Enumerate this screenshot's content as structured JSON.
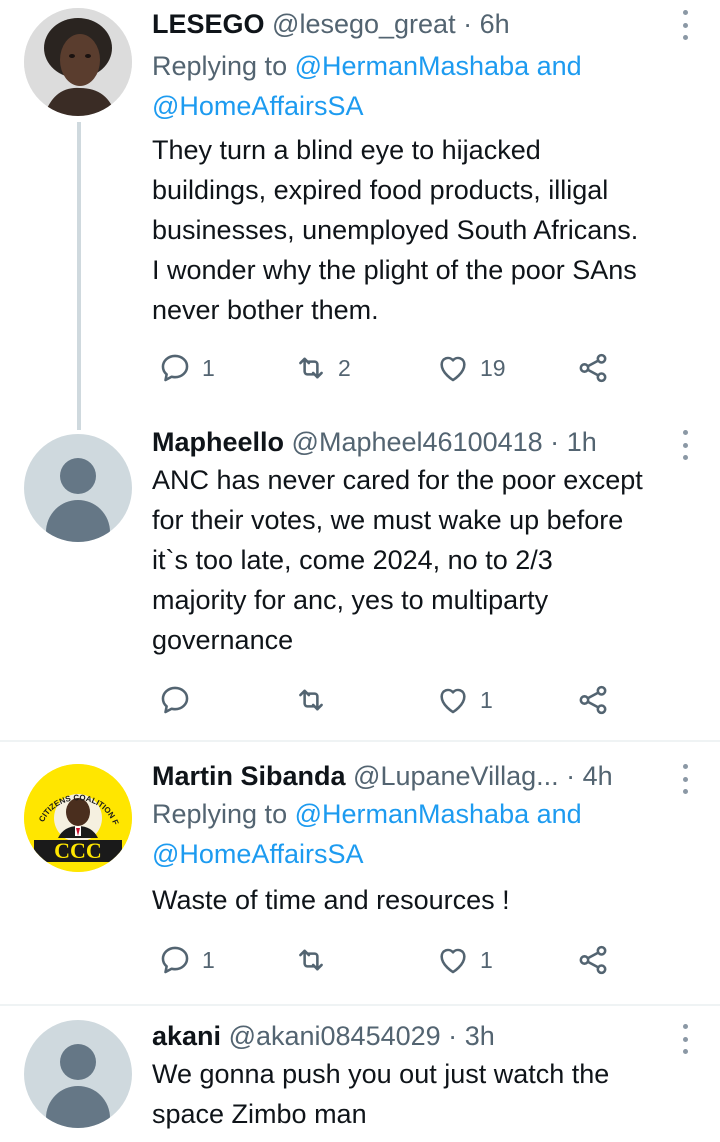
{
  "tweets": [
    {
      "name": "LESEGO",
      "handle": "@lesego_great",
      "dot": "·",
      "time": "6h",
      "replying_prefix": "Replying to ",
      "replying_to_1": "@HermanMashaba",
      "replying_and": " and",
      "replying_to_2": "@HomeAffairsSA",
      "text_lines": [
        "They turn a blind eye to hijacked",
        "buildings, expired food products, illigal",
        "businesses, unemployed South Africans.",
        "I wonder why the plight of the poor SAns",
        "never bother them."
      ],
      "replies": "1",
      "retweets": "2",
      "likes": "19"
    },
    {
      "name": "Mapheello",
      "handle": "@Mapheel46100418",
      "dot": "·",
      "time": "1h",
      "text_lines": [
        "ANC has never cared for the poor except",
        "for their votes, we must wake up before",
        "it`s too late, come 2024, no to 2/3",
        "majority for anc, yes to multiparty",
        "governance"
      ],
      "replies": "",
      "retweets": "",
      "likes": "1"
    },
    {
      "name": "Martin Sibanda",
      "handle": "@LupaneVillag...",
      "dot": "·",
      "time": "4h",
      "replying_prefix": "Replying to ",
      "replying_to_1": "@HermanMashaba",
      "replying_and": " and",
      "replying_to_2": "@HomeAffairsSA",
      "text_lines": [
        "Waste of time and resources !"
      ],
      "replies": "1",
      "retweets": "",
      "likes": "1",
      "avatar_logo_text": "CCC",
      "avatar_ring_text": "CITIZENS COALITION FOR CHANGE"
    },
    {
      "name": "akani",
      "handle": "@akani08454029",
      "dot": "·",
      "time": "3h",
      "text_lines": [
        "We gonna push you out just watch the",
        "space Zimbo man"
      ]
    }
  ],
  "icons": {
    "reply": "reply-icon",
    "retweet": "retweet-icon",
    "like": "heart-icon",
    "share": "share-icon",
    "more": "more-vertical-icon"
  },
  "colors": {
    "link": "#1d9bf0",
    "secondary_text": "#536471",
    "divider": "#eff3f4",
    "thread_line": "#cfd9de"
  }
}
